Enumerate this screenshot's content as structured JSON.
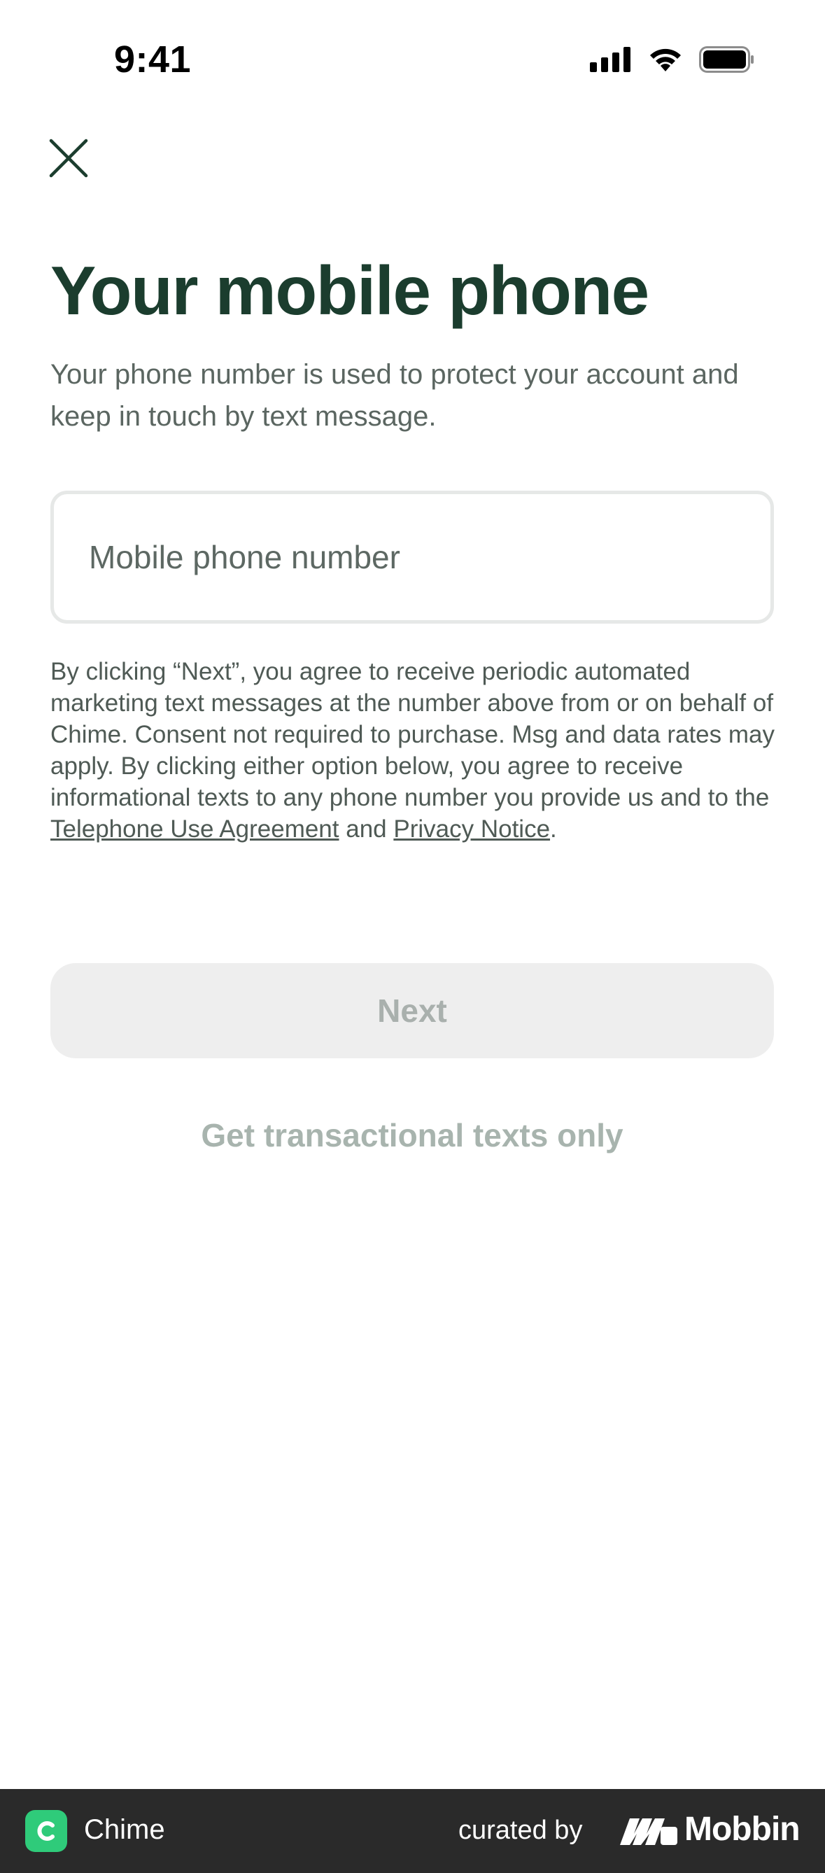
{
  "status_bar": {
    "time": "9:41",
    "icons": [
      "signal-icon",
      "wifi-icon",
      "battery-icon"
    ]
  },
  "header": {
    "close_icon": "close-icon"
  },
  "main": {
    "title": "Your mobile phone",
    "subtitle": "Your phone number is used to protect your account and keep in touch by text message.",
    "phone_input": {
      "value": "",
      "placeholder": "Mobile phone number"
    },
    "legal": {
      "text": "By clicking “Next”, you agree to receive periodic automated marketing text messages at the number above from or on behalf of Chime. Consent not required to purchase. Msg and data rates may apply. By clicking either option below, you agree to receive informational texts to any phone number you provide us and to the ",
      "link_telephone": "Telephone Use Agreement",
      "connector": " and ",
      "link_privacy": "Privacy Notice",
      "end": "."
    },
    "next_label": "Next",
    "secondary_label": "Get transactional texts only"
  },
  "footer": {
    "app_name": "Chime",
    "app_icon": "chime-app-icon",
    "curated_by": "curated by",
    "brand": "Mobbin",
    "brand_logo": "mobbin-logo-icon"
  },
  "colors": {
    "title": "#1b3d2e",
    "text": "#5b6661",
    "button_bg": "#eeeeee",
    "button_text": "#a9b0ad",
    "secondary_text": "#a8b4ae",
    "footer_bg": "#2a2a2a",
    "chime_green": "#2fcb7a"
  }
}
